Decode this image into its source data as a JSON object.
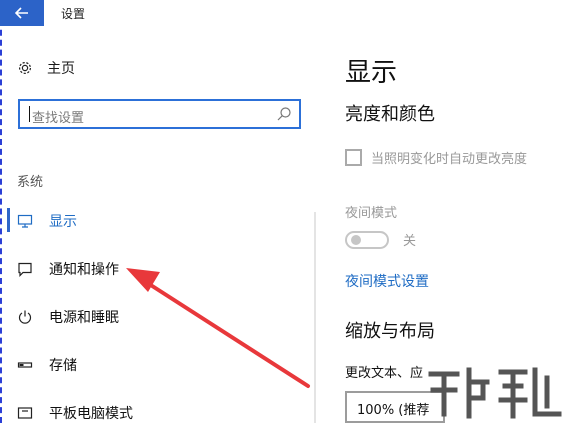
{
  "window": {
    "title": "设置",
    "accent_color": "#2c63c8"
  },
  "sidebar": {
    "home_label": "主页",
    "search_placeholder": "查找设置",
    "section_title": "系统",
    "items": [
      {
        "label": "显示",
        "icon": "monitor-icon",
        "active": true
      },
      {
        "label": "通知和操作",
        "icon": "notification-icon",
        "active": false
      },
      {
        "label": "电源和睡眠",
        "icon": "power-icon",
        "active": false
      },
      {
        "label": "存储",
        "icon": "storage-icon",
        "active": false
      },
      {
        "label": "平板电脑模式",
        "icon": "tablet-mode-icon",
        "active": false
      }
    ]
  },
  "main": {
    "title": "显示",
    "brightness_heading": "亮度和颜色",
    "auto_brightness_label": "当照明变化时自动更改亮度",
    "night_mode_label": "夜间模式",
    "night_mode_state": "关",
    "night_mode_settings_link": "夜间模式设置",
    "scale_heading": "缩放与布局",
    "change_text_label": "更改文本、应",
    "scale_value": "100% (推荐"
  },
  "annotation": {
    "arrow_color": "#e8383b"
  }
}
